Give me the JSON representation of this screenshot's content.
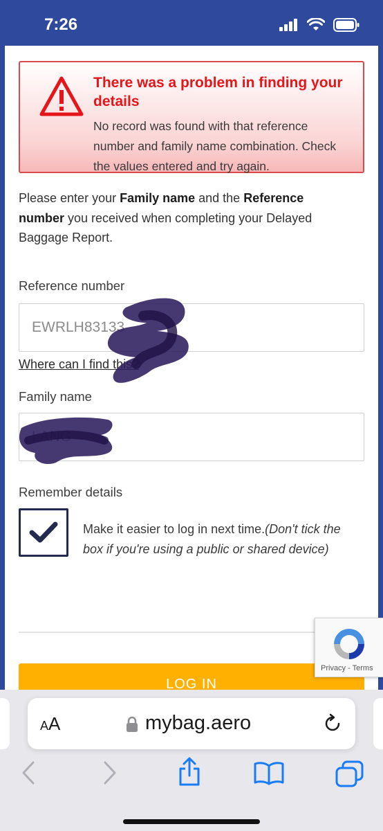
{
  "status_bar": {
    "time": "7:26"
  },
  "alert": {
    "title": "There was a problem in finding your details",
    "body": "No record was found with that reference number and family name combination. Check the values entered and try again.",
    "icon": "warning-triangle-icon",
    "colors": {
      "title": "#e4161c",
      "border": "#d94a4a"
    }
  },
  "intro": {
    "part1": "Please enter your ",
    "bold1": "Family name",
    "part2": " and the ",
    "bold2": "Reference number",
    "part3": " you received when completing your Delayed Baggage Report."
  },
  "form": {
    "reference_label": "Reference number",
    "reference_value": "EWRLH83133",
    "find_link": "Where can I find this?",
    "family_label": "Family name",
    "family_value": "LANG",
    "remember_label": "Remember details",
    "remember_checked": true,
    "remember_text": "Make it easier to log in next time.",
    "remember_note": "(Don't tick the box if you're using a public or shared device)",
    "login_button": "LOG IN"
  },
  "recaptcha": {
    "privacy": "Privacy",
    "separator": " - ",
    "terms": "Terms"
  },
  "browser": {
    "aa_label_small": "A",
    "aa_label": "A",
    "url": "mybag.aero"
  },
  "colors": {
    "brand_blue": "#2f4a9c",
    "login_orange": "#ffb000",
    "checkbox_navy": "#23294f"
  }
}
